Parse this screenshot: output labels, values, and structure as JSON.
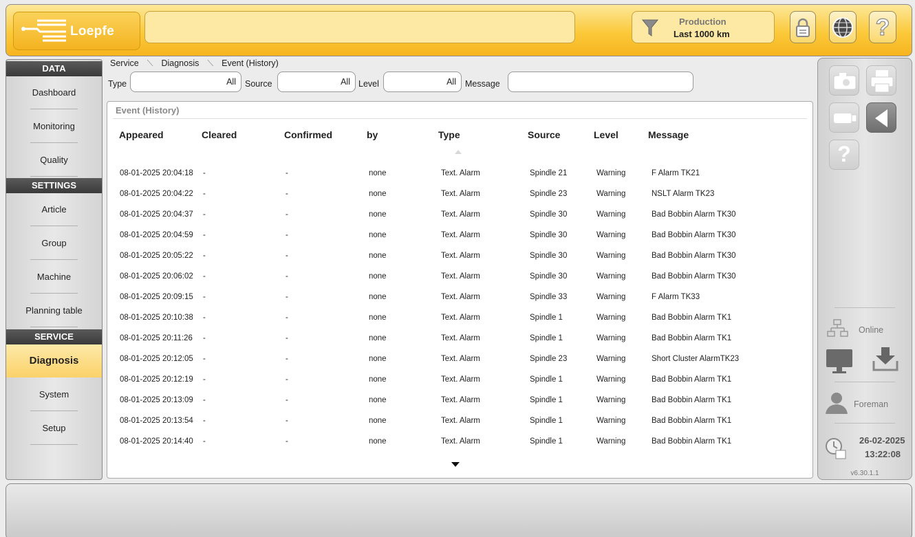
{
  "header": {
    "logo_text": "Loepfe",
    "status_text": "",
    "production": {
      "title": "Production",
      "subtitle": "Last 1000 km"
    },
    "buttons": {
      "lock_icon": "lock-icon",
      "globe_icon": "globe-icon",
      "help_label": "?"
    }
  },
  "colors": {
    "header_accent": "#fbc93a",
    "active_nav": "#fbd269",
    "nav_header": "#3a3a3a"
  },
  "sidebar": {
    "sections": [
      {
        "title": "DATA",
        "items": [
          "Dashboard",
          "Monitoring",
          "Quality"
        ]
      },
      {
        "title": "SETTINGS",
        "items": [
          "Article",
          "Group",
          "Machine",
          "Planning table"
        ]
      },
      {
        "title": "SERVICE",
        "items": [
          "Diagnosis",
          "System",
          "Setup"
        ]
      }
    ],
    "active_item": "Diagnosis"
  },
  "breadcrumb": [
    "Service",
    "Diagnosis",
    "Event (History)"
  ],
  "filters": {
    "type": {
      "label": "Type",
      "value": "All"
    },
    "source": {
      "label": "Source",
      "value": "All"
    },
    "level": {
      "label": "Level",
      "value": "All"
    },
    "message": {
      "label": "Message",
      "value": ""
    }
  },
  "table": {
    "title": "Event (History)",
    "columns": [
      "Appeared",
      "Cleared",
      "Confirmed",
      "by",
      "Type",
      "Source",
      "Level",
      "Message"
    ],
    "rows": [
      [
        "08-01-2025 20:04:18",
        "-",
        "-",
        "none",
        "Text. Alarm",
        "Spindle 21",
        "Warning",
        "F Alarm TK21"
      ],
      [
        "08-01-2025 20:04:22",
        "-",
        "-",
        "none",
        "Text. Alarm",
        "Spindle 23",
        "Warning",
        "NSLT Alarm TK23"
      ],
      [
        "08-01-2025 20:04:37",
        "-",
        "-",
        "none",
        "Text. Alarm",
        "Spindle 30",
        "Warning",
        "Bad Bobbin Alarm TK30"
      ],
      [
        "08-01-2025 20:04:59",
        "-",
        "-",
        "none",
        "Text. Alarm",
        "Spindle 30",
        "Warning",
        "Bad Bobbin Alarm TK30"
      ],
      [
        "08-01-2025 20:05:22",
        "-",
        "-",
        "none",
        "Text. Alarm",
        "Spindle 30",
        "Warning",
        "Bad Bobbin Alarm TK30"
      ],
      [
        "08-01-2025 20:06:02",
        "-",
        "-",
        "none",
        "Text. Alarm",
        "Spindle 30",
        "Warning",
        "Bad Bobbin Alarm TK30"
      ],
      [
        "08-01-2025 20:09:15",
        "-",
        "-",
        "none",
        "Text. Alarm",
        "Spindle 33",
        "Warning",
        "F Alarm TK33"
      ],
      [
        "08-01-2025 20:10:38",
        "-",
        "-",
        "none",
        "Text. Alarm",
        "Spindle 1",
        "Warning",
        "Bad Bobbin Alarm TK1"
      ],
      [
        "08-01-2025 20:11:26",
        "-",
        "-",
        "none",
        "Text. Alarm",
        "Spindle 1",
        "Warning",
        "Bad Bobbin Alarm TK1"
      ],
      [
        "08-01-2025 20:12:05",
        "-",
        "-",
        "none",
        "Text. Alarm",
        "Spindle 23",
        "Warning",
        "Short Cluster AlarmTK23"
      ],
      [
        "08-01-2025 20:12:19",
        "-",
        "-",
        "none",
        "Text. Alarm",
        "Spindle 1",
        "Warning",
        "Bad Bobbin Alarm TK1"
      ],
      [
        "08-01-2025 20:13:09",
        "-",
        "-",
        "none",
        "Text. Alarm",
        "Spindle 1",
        "Warning",
        "Bad Bobbin Alarm TK1"
      ],
      [
        "08-01-2025 20:13:54",
        "-",
        "-",
        "none",
        "Text. Alarm",
        "Spindle 1",
        "Warning",
        "Bad Bobbin Alarm TK1"
      ],
      [
        "08-01-2025 20:14:40",
        "-",
        "-",
        "none",
        "Text. Alarm",
        "Spindle 1",
        "Warning",
        "Bad Bobbin Alarm TK1"
      ]
    ]
  },
  "right_panel": {
    "buttons": [
      "camera-icon",
      "printer-icon",
      "usb-icon",
      "back-icon",
      "help-icon"
    ],
    "help_label": "?",
    "connection": "Online",
    "user": "Foreman",
    "date": "26-02-2025",
    "time": "13:22:08",
    "version": "v6.30.1.1"
  }
}
